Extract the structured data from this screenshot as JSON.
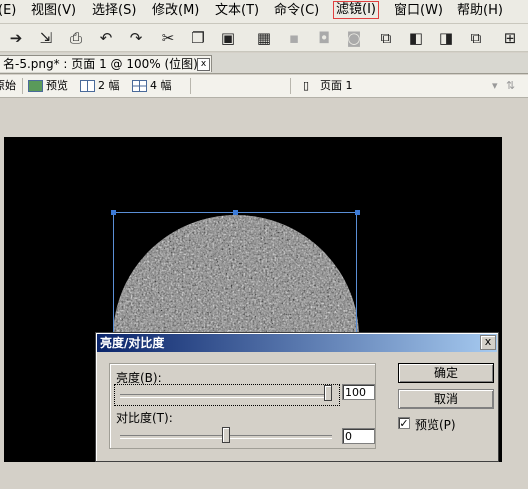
{
  "menubar": {
    "items": [
      {
        "label": "(E)"
      },
      {
        "label": "视图(V)"
      },
      {
        "label": "选择(S)"
      },
      {
        "label": "修改(M)"
      },
      {
        "label": "文本(T)"
      },
      {
        "label": "命令(C)"
      },
      {
        "label": "滤镜(I)"
      },
      {
        "label": "窗口(W)"
      },
      {
        "label": "帮助(H)"
      }
    ]
  },
  "toolbar": {
    "icons": [
      "import-icon",
      "export-icon",
      "print-icon",
      "undo-icon",
      "redo-icon",
      "cut-icon",
      "copy-icon",
      "paste-icon",
      "group-icon",
      "ungroup-icon",
      "join-icon",
      "split-icon",
      "bring-to-front-icon",
      "bring-forward-icon",
      "send-backward-icon",
      "send-to-back-icon"
    ]
  },
  "document": {
    "tab_title": "名-5.png* : 页面 1 @ 100% (位图)",
    "close_glyph": "x"
  },
  "viewbar": {
    "original_label": "原始",
    "preview_label": "预览",
    "two_up_label": "2 幅",
    "four_up_label": "4 幅",
    "page_label": "页面 1"
  },
  "dialog": {
    "title": "亮度/对比度",
    "close_glyph": "x",
    "brightness_label": "亮度(B):",
    "brightness_value": "100",
    "brightness_fraction": 1.0,
    "contrast_label": "对比度(T):",
    "contrast_value": "0",
    "contrast_fraction": 0.5,
    "ok_label": "确定",
    "cancel_label": "取消",
    "preview_label": "预览(P)",
    "preview_checked": "✓"
  },
  "colors": {
    "highlight_outline": "#e04040",
    "selection_blue": "#3c7bd8",
    "titlebar_start": "#0a246a",
    "titlebar_end": "#a6caf0"
  }
}
